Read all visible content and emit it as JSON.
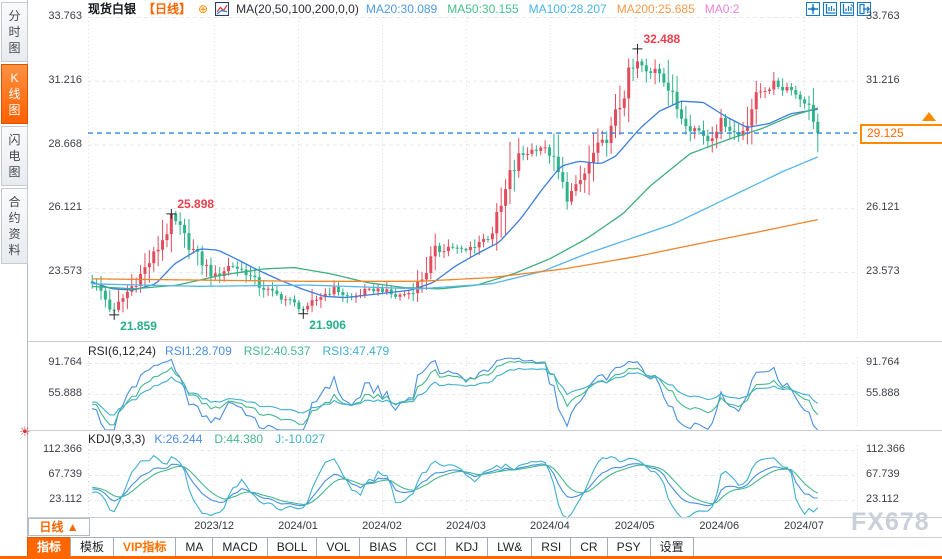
{
  "window": {
    "watermark": "FX678"
  },
  "sidebar": {
    "tabs": [
      {
        "label": "分时图",
        "active": false
      },
      {
        "label": "K线图",
        "active": true
      },
      {
        "label": "闪电图",
        "active": false
      },
      {
        "label": "合约资料",
        "active": false
      }
    ]
  },
  "header": {
    "symbol": "现货白银",
    "period_tag": "【日线】",
    "add_icon": "⊕",
    "formula": "MA(20,50,100,200,0,0)",
    "ma_values": [
      {
        "label": "MA20:30.089",
        "color": "#4f9be0"
      },
      {
        "label": "MA50:30.155",
        "color": "#47c08e"
      },
      {
        "label": "MA100:28.207",
        "color": "#49b4e6"
      },
      {
        "label": "MA200:25.685",
        "color": "#f59a4c"
      },
      {
        "label": "MA0:2",
        "color": "#e982dd"
      }
    ]
  },
  "rsi_panel": {
    "title": "RSI(6,12,24)",
    "values": [
      {
        "label": "RSI1:28.709",
        "color": "#4a8fe2"
      },
      {
        "label": "RSI2:40.537",
        "color": "#44b98c"
      },
      {
        "label": "RSI3:47.479",
        "color": "#3fb0cf"
      }
    ],
    "tick_labels": [
      "91.764",
      "55.888"
    ]
  },
  "kdj_panel": {
    "title": "KDJ(9,3,3)",
    "values": [
      {
        "label": "K:26.244",
        "color": "#4a8fe2"
      },
      {
        "label": "D:44.380",
        "color": "#44b98c"
      },
      {
        "label": "J:-10.027",
        "color": "#3fb0cf"
      }
    ],
    "tick_labels": [
      "112.366",
      "67.739",
      "23.112"
    ],
    "settings_icon": "☀"
  },
  "x_axis": {
    "period_label": "日线",
    "period_arrow": "▲",
    "months": [
      "2023/12",
      "2024/01",
      "2024/02",
      "2024/03",
      "2024/04",
      "2024/05",
      "2024/06",
      "2024/07"
    ]
  },
  "toolbar": {
    "buttons": [
      {
        "label": "指标",
        "style": "active"
      },
      {
        "label": "模板",
        "style": "normal"
      },
      {
        "label": "VIP指标",
        "style": "vip"
      },
      {
        "label": "MA",
        "style": "normal"
      },
      {
        "label": "MACD",
        "style": "normal"
      },
      {
        "label": "BOLL",
        "style": "normal"
      },
      {
        "label": "VOL",
        "style": "normal"
      },
      {
        "label": "BIAS",
        "style": "normal"
      },
      {
        "label": "CCI",
        "style": "normal"
      },
      {
        "label": "KDJ",
        "style": "normal"
      },
      {
        "label": "LW&",
        "style": "normal"
      },
      {
        "label": "RSI",
        "style": "normal"
      },
      {
        "label": "CR",
        "style": "normal"
      },
      {
        "label": "PSY",
        "style": "normal"
      },
      {
        "label": "设置",
        "style": "normal"
      }
    ]
  },
  "chart_data": {
    "type": "candlestick",
    "symbol": "现货白银",
    "period": "日线",
    "y_axis": {
      "ticks": [
        33.763,
        31.216,
        28.668,
        26.121,
        23.573
      ],
      "tick_labels": [
        "33.763",
        "31.216",
        "28.668",
        "26.121",
        "23.573"
      ]
    },
    "last_price": "29.125",
    "last_price_value": 29.125,
    "months_t": [
      0.17,
      0.285,
      0.4,
      0.515,
      0.63,
      0.746,
      0.862,
      0.978
    ],
    "candle_count": 166,
    "annotations": [
      {
        "t": 0.032,
        "price": 21.859,
        "label": "21.859",
        "kind": "low"
      },
      {
        "t": 0.114,
        "price": 25.898,
        "label": "25.898",
        "kind": "high"
      },
      {
        "t": 0.295,
        "price": 21.906,
        "label": "21.906",
        "kind": "low"
      },
      {
        "t": 0.753,
        "price": 32.488,
        "label": "32.488",
        "kind": "high"
      }
    ],
    "close_path": [
      [
        0,
        23.3
      ],
      [
        0.014,
        22.85
      ],
      [
        0.032,
        21.95
      ],
      [
        0.048,
        22.65
      ],
      [
        0.068,
        23.4
      ],
      [
        0.089,
        24.3
      ],
      [
        0.103,
        25.1
      ],
      [
        0.114,
        25.75
      ],
      [
        0.13,
        24.9
      ],
      [
        0.151,
        24.05
      ],
      [
        0.171,
        23.35
      ],
      [
        0.192,
        23.85
      ],
      [
        0.212,
        23.6
      ],
      [
        0.233,
        23.0
      ],
      [
        0.253,
        22.7
      ],
      [
        0.274,
        22.4
      ],
      [
        0.295,
        22.05
      ],
      [
        0.315,
        22.6
      ],
      [
        0.336,
        22.9
      ],
      [
        0.356,
        22.5
      ],
      [
        0.377,
        22.8
      ],
      [
        0.397,
        22.9
      ],
      [
        0.418,
        22.6
      ],
      [
        0.438,
        22.75
      ],
      [
        0.452,
        23.2
      ],
      [
        0.473,
        24.35
      ],
      [
        0.493,
        24.6
      ],
      [
        0.514,
        24.4
      ],
      [
        0.534,
        24.8
      ],
      [
        0.548,
        25.0
      ],
      [
        0.562,
        26.0
      ],
      [
        0.575,
        27.3
      ],
      [
        0.589,
        28.2
      ],
      [
        0.603,
        28.4
      ],
      [
        0.616,
        28.6
      ],
      [
        0.63,
        28.3
      ],
      [
        0.641,
        27.5
      ],
      [
        0.652,
        26.6
      ],
      [
        0.664,
        26.85
      ],
      [
        0.678,
        27.5
      ],
      [
        0.692,
        28.4
      ],
      [
        0.705,
        28.8
      ],
      [
        0.715,
        29.3
      ],
      [
        0.726,
        30.3
      ],
      [
        0.74,
        31.5
      ],
      [
        0.753,
        32.0
      ],
      [
        0.764,
        31.3
      ],
      [
        0.774,
        31.8
      ],
      [
        0.784,
        31.5
      ],
      [
        0.795,
        30.7
      ],
      [
        0.808,
        29.9
      ],
      [
        0.822,
        29.4
      ],
      [
        0.836,
        29.2
      ],
      [
        0.847,
        28.85
      ],
      [
        0.856,
        29.3
      ],
      [
        0.866,
        29.6
      ],
      [
        0.877,
        29.3
      ],
      [
        0.888,
        29.0
      ],
      [
        0.897,
        29.4
      ],
      [
        0.907,
        30.2
      ],
      [
        0.918,
        30.8
      ],
      [
        0.929,
        30.9
      ],
      [
        0.938,
        31.1
      ],
      [
        0.948,
        30.9
      ],
      [
        0.959,
        31.0
      ],
      [
        0.968,
        30.6
      ],
      [
        0.979,
        30.4
      ],
      [
        0.989,
        29.9
      ],
      [
        1,
        29.125
      ]
    ],
    "ma_series": [
      {
        "name": "MA20",
        "color": "#3b7edb",
        "path": [
          [
            0,
            23.2
          ],
          [
            0.03,
            22.9
          ],
          [
            0.06,
            22.85
          ],
          [
            0.09,
            23.1
          ],
          [
            0.116,
            23.9
          ],
          [
            0.15,
            24.5
          ],
          [
            0.175,
            24.45
          ],
          [
            0.2,
            24.1
          ],
          [
            0.23,
            23.65
          ],
          [
            0.26,
            23.25
          ],
          [
            0.29,
            22.9
          ],
          [
            0.32,
            22.6
          ],
          [
            0.35,
            22.55
          ],
          [
            0.38,
            22.65
          ],
          [
            0.41,
            22.75
          ],
          [
            0.44,
            22.85
          ],
          [
            0.47,
            23.15
          ],
          [
            0.5,
            23.8
          ],
          [
            0.53,
            24.3
          ],
          [
            0.56,
            24.75
          ],
          [
            0.59,
            25.7
          ],
          [
            0.62,
            26.9
          ],
          [
            0.645,
            27.8
          ],
          [
            0.67,
            28.0
          ],
          [
            0.7,
            27.9
          ],
          [
            0.72,
            28.2
          ],
          [
            0.753,
            29.3
          ],
          [
            0.78,
            30.0
          ],
          [
            0.81,
            30.4
          ],
          [
            0.84,
            30.35
          ],
          [
            0.87,
            29.8
          ],
          [
            0.9,
            29.35
          ],
          [
            0.93,
            29.5
          ],
          [
            0.96,
            29.9
          ],
          [
            1,
            30.089
          ]
        ]
      },
      {
        "name": "MA50",
        "color": "#3fae7e",
        "path": [
          [
            0,
            23.0
          ],
          [
            0.06,
            22.9
          ],
          [
            0.12,
            23.05
          ],
          [
            0.18,
            23.45
          ],
          [
            0.24,
            23.7
          ],
          [
            0.28,
            23.75
          ],
          [
            0.33,
            23.5
          ],
          [
            0.38,
            23.15
          ],
          [
            0.43,
            22.95
          ],
          [
            0.48,
            22.9
          ],
          [
            0.53,
            23.05
          ],
          [
            0.58,
            23.5
          ],
          [
            0.63,
            24.1
          ],
          [
            0.68,
            24.9
          ],
          [
            0.73,
            25.9
          ],
          [
            0.767,
            27.0
          ],
          [
            0.822,
            28.3
          ],
          [
            0.877,
            28.9
          ],
          [
            0.92,
            29.3
          ],
          [
            0.96,
            29.8
          ],
          [
            1,
            30.155
          ]
        ]
      },
      {
        "name": "MA100",
        "color": "#57b6e8",
        "path": [
          [
            0,
            23.1
          ],
          [
            0.15,
            23.0
          ],
          [
            0.3,
            23.05
          ],
          [
            0.45,
            22.9
          ],
          [
            0.55,
            23.1
          ],
          [
            0.62,
            23.6
          ],
          [
            0.68,
            24.3
          ],
          [
            0.74,
            24.9
          ],
          [
            0.8,
            25.5
          ],
          [
            0.85,
            26.2
          ],
          [
            0.9,
            26.9
          ],
          [
            0.95,
            27.6
          ],
          [
            1,
            28.207
          ]
        ]
      },
      {
        "name": "MA200",
        "color": "#f0862c",
        "path": [
          [
            0,
            23.3
          ],
          [
            0.15,
            23.25
          ],
          [
            0.3,
            23.2
          ],
          [
            0.45,
            23.2
          ],
          [
            0.55,
            23.35
          ],
          [
            0.65,
            23.7
          ],
          [
            0.75,
            24.2
          ],
          [
            0.85,
            24.8
          ],
          [
            0.92,
            25.2
          ],
          [
            1,
            25.685
          ]
        ]
      }
    ],
    "rsi": {
      "periods": [
        6,
        12,
        24
      ],
      "colors": [
        "#4a8fe2",
        "#44b98c",
        "#3fb0cf"
      ],
      "ticks": [
        91.764,
        55.888
      ]
    },
    "kdj": {
      "params": [
        9,
        3,
        3
      ],
      "colors": [
        "#4a8fe2",
        "#44b98c",
        "#3fb0cf"
      ],
      "ticks": [
        112.366,
        67.739,
        23.112
      ]
    },
    "colors": {
      "up": "#e14d5d",
      "down": "#2fb38a",
      "current_line": "#2f86e0",
      "grid": "#e7eaf0",
      "vgrid": "#d4dae4",
      "annotation_high": "#e8404d",
      "annotation_low": "#23b08c"
    }
  }
}
